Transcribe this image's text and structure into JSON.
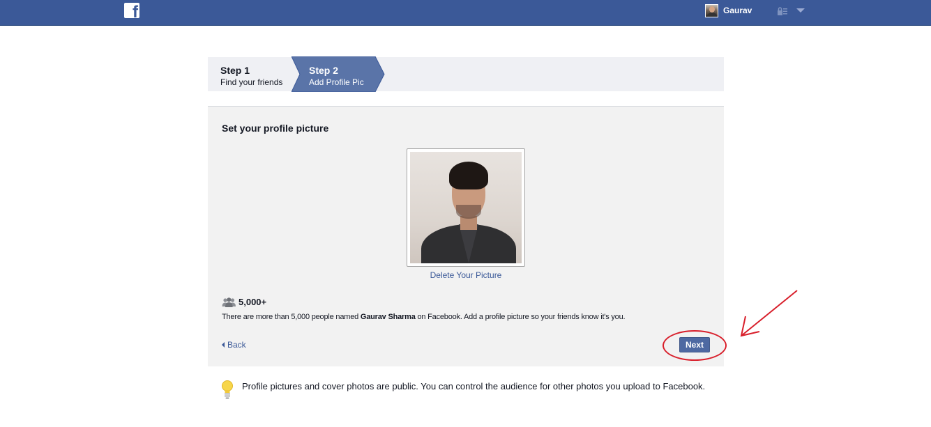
{
  "header": {
    "logo_letter": "f",
    "user_name": "Gaurav"
  },
  "steps": [
    {
      "title": "Step 1",
      "subtitle": "Find your friends"
    },
    {
      "title": "Step 2",
      "subtitle": "Add Profile Pic"
    }
  ],
  "panel": {
    "title": "Set your profile picture",
    "delete_link": "Delete Your Picture",
    "count": "5,000+",
    "description_before": "There are more than 5,000 people named ",
    "description_name": "Gaurav Sharma",
    "description_after": " on Facebook. Add a profile picture so your friends know it's you.",
    "back_label": "Back",
    "next_label": "Next"
  },
  "tip": {
    "text": "Profile pictures and cover photos are public. You can control the audience for other photos you upload to Facebook."
  },
  "colors": {
    "brand": "#3b5998",
    "button": "#4e69a2",
    "annotation": "#d81e2a"
  },
  "icons": [
    "facebook-logo-icon",
    "lock-icon",
    "chevron-down-icon",
    "people-icon",
    "lightbulb-icon",
    "back-caret-icon"
  ]
}
